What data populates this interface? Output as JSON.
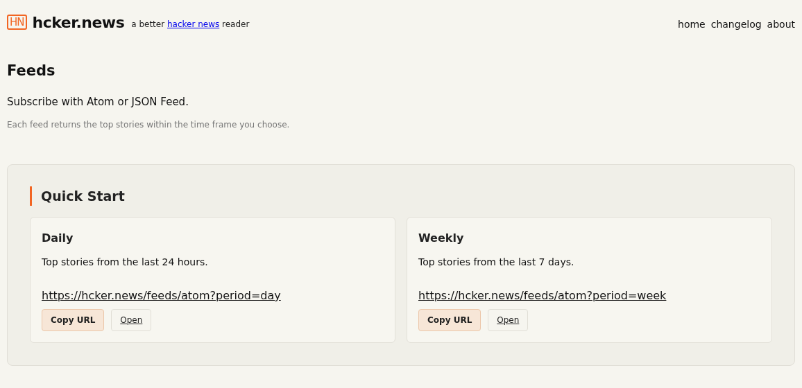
{
  "header": {
    "logo": "HN",
    "site_name": "hcker.news",
    "tagline": {
      "before": "a better",
      "link": "hacker news",
      "after": "reader"
    },
    "nav": [
      {
        "label": "home"
      },
      {
        "label": "changelog"
      },
      {
        "label": "about"
      }
    ]
  },
  "page": {
    "title": "Feeds",
    "intro": "Subscribe with Atom or JSON Feed.",
    "note": "Each feed returns the top stories within the time frame you choose."
  },
  "quick_start": {
    "title": "Quick Start",
    "feeds": [
      {
        "name": "Daily",
        "description": "Top stories from the last 24 hours.",
        "url": "https://hcker.news/feeds/atom?period=day",
        "buttons": [
          {
            "label": "Copy URL",
            "kind": "primary"
          },
          {
            "label": "Open",
            "kind": "link"
          }
        ]
      },
      {
        "name": "Weekly",
        "description": "Top stories from the last 7 days.",
        "url": "https://hcker.news/feeds/atom?period=week",
        "buttons": [
          {
            "label": "Copy URL",
            "kind": "primary"
          },
          {
            "label": "Open",
            "kind": "link"
          }
        ]
      }
    ]
  }
}
